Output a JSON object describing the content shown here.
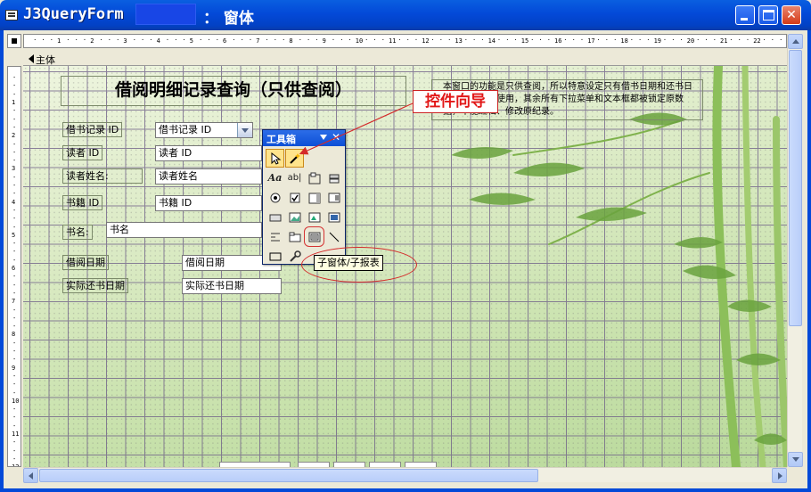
{
  "window": {
    "title": "J3QueryForm",
    "title_suffix": "： 窗体"
  },
  "ruler": {
    "h_marks": [
      "1",
      "2",
      "3",
      "4",
      "5",
      "6",
      "7",
      "8",
      "9",
      "10",
      "11",
      "12",
      "13",
      "14",
      "15",
      "16",
      "17",
      "18",
      "19",
      "20",
      "21",
      "22",
      "2"
    ],
    "v_marks": [
      "1",
      "2",
      "3",
      "4",
      "5",
      "6",
      "7",
      "8",
      "9",
      "10",
      "11",
      "12"
    ]
  },
  "section": {
    "label": "主体"
  },
  "form": {
    "title": "借阅明细记录查询（只供查阅）",
    "note": "本窗口的功能是只供查阅，所以特意设定只有借书日期和还书日期可以供选择使用，其余所有下拉菜单和文本框都被锁定原数据，不能编辑、修改原纪录。",
    "fields": [
      {
        "label": "借书记录 ID",
        "value": "借书记录 ID"
      },
      {
        "label": "读者 ID",
        "value": "读者 ID"
      },
      {
        "label": "读者姓名:",
        "value": "读者姓名"
      },
      {
        "label": "书籍 ID",
        "value": "书籍 ID"
      },
      {
        "label": "书名:",
        "value": "书名"
      },
      {
        "label": "借阅日期",
        "value": "借阅日期"
      },
      {
        "label": "实际还书日期",
        "value": "实际还书日期"
      }
    ]
  },
  "toolbox": {
    "title": "工具箱",
    "close": "✕"
  },
  "callouts": {
    "wizard": "控件向导",
    "tooltip": "子窗体/子报表"
  },
  "colors": {
    "titlebar": "#0349d8",
    "callout_red": "#e21818",
    "grid": "#6b5a86"
  }
}
